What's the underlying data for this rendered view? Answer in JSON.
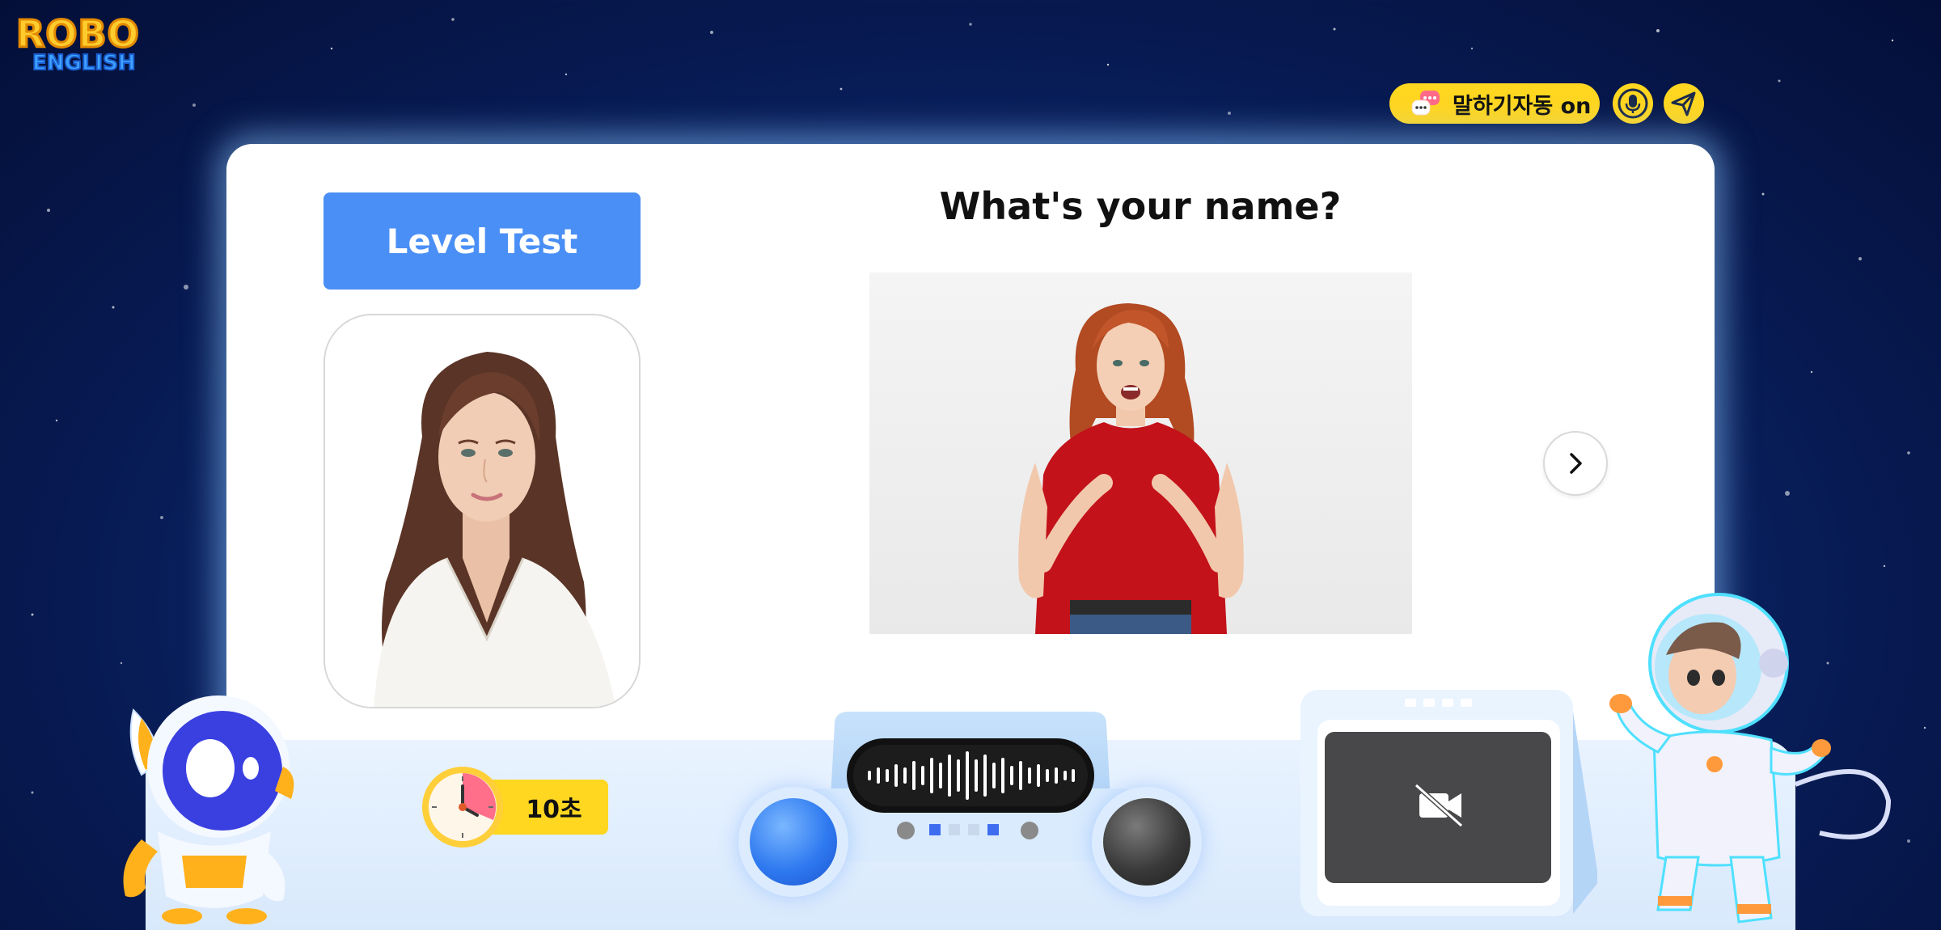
{
  "logo": {
    "line1": "ROBO",
    "line2": "ENGLISH"
  },
  "toolbar": {
    "auto_speak_label": "말하기자동 on",
    "auto_speak_icon": "chat-bubble-icon",
    "mic_icon": "microphone-icon",
    "send_icon": "paper-plane-icon",
    "accent_color": "#ffd620"
  },
  "card": {
    "level_test_label": "Level Test",
    "question": "What's your name?",
    "next_icon": "chevron-right-icon"
  },
  "controls": {
    "timer_text": "10초",
    "timer_icon": "clock-icon",
    "record_button_color": "#2f7af0",
    "stop_button_color": "#3a3a3a",
    "camera_status_icon": "camera-off-icon"
  },
  "colors": {
    "primary_blue": "#4a8ff5",
    "background_navy": "#071a52"
  }
}
